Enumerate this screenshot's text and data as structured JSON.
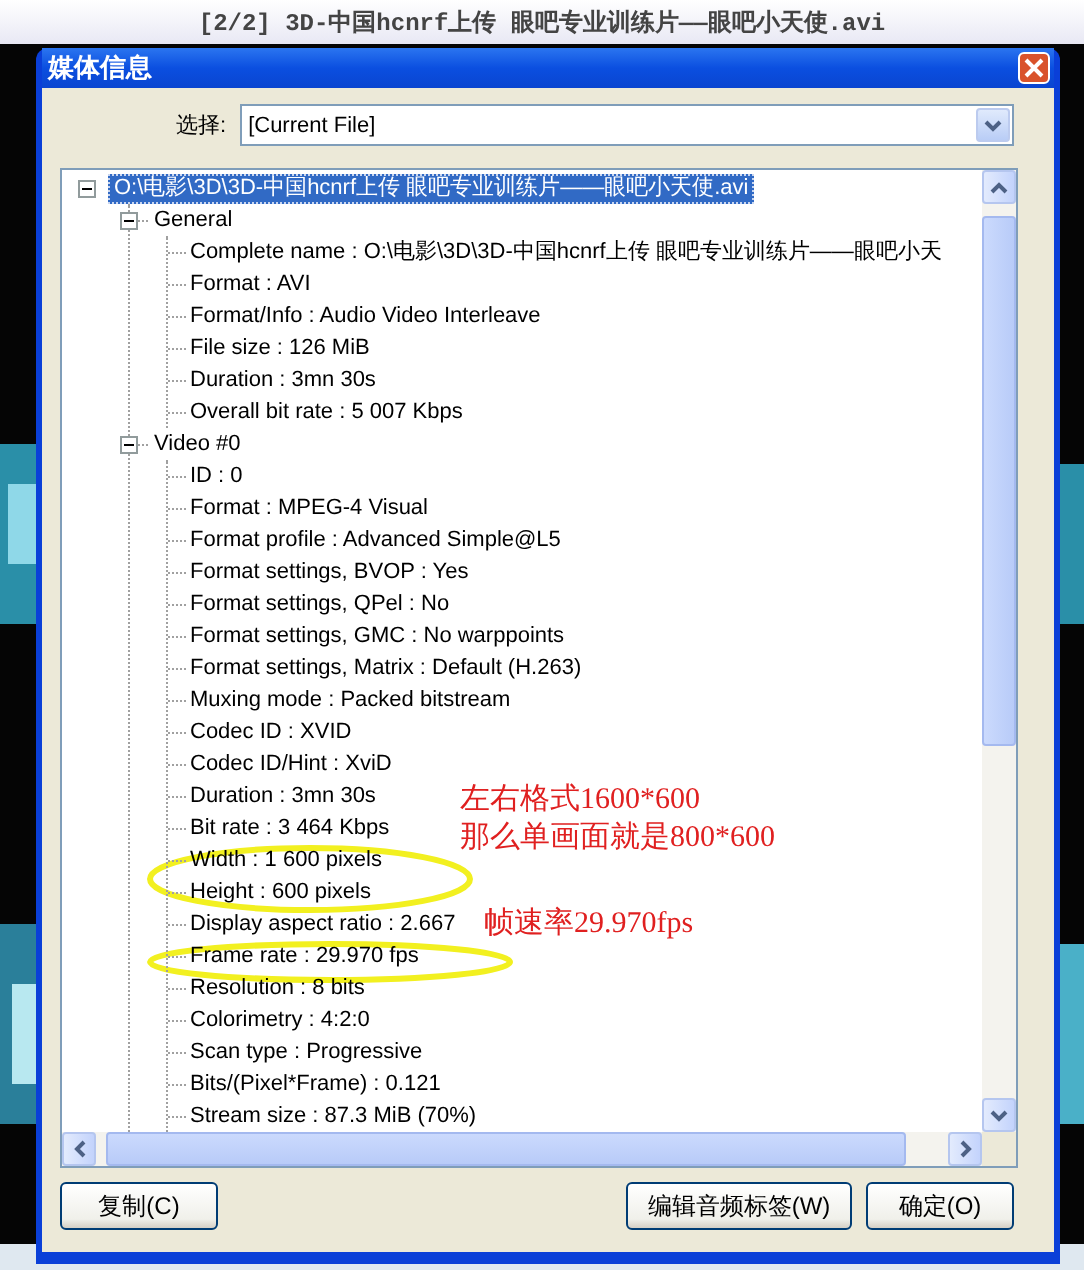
{
  "player_title": "[2/2] 3D-中国hcnrf上传 眼吧专业训练片——眼吧小天使.avi",
  "dialog": {
    "title": "媒体信息",
    "select_label": "选择:",
    "select_value": "[Current File]",
    "tree": {
      "label": "O:\\电影\\3D\\3D-中国hcnrf上传 眼吧专业训练片——眼吧小天使.avi",
      "expanded": true,
      "selected": true,
      "children": [
        {
          "label": "General",
          "expanded": true,
          "selected": false,
          "children": [
            {
              "label": "Complete name : O:\\电影\\3D\\3D-中国hcnrf上传 眼吧专业训练片——眼吧小天",
              "selected": false
            },
            {
              "label": "Format : AVI",
              "selected": false
            },
            {
              "label": "Format/Info : Audio Video Interleave",
              "selected": false
            },
            {
              "label": "File size : 126 MiB",
              "selected": false
            },
            {
              "label": "Duration : 3mn 30s",
              "selected": false
            },
            {
              "label": "Overall bit rate : 5 007 Kbps",
              "selected": false
            }
          ]
        },
        {
          "label": "Video #0",
          "expanded": true,
          "selected": false,
          "children": [
            {
              "label": "ID : 0",
              "selected": false
            },
            {
              "label": "Format : MPEG-4 Visual",
              "selected": false
            },
            {
              "label": "Format profile : Advanced Simple@L5",
              "selected": false
            },
            {
              "label": "Format settings, BVOP : Yes",
              "selected": false
            },
            {
              "label": "Format settings, QPel : No",
              "selected": false
            },
            {
              "label": "Format settings, GMC : No warppoints",
              "selected": false
            },
            {
              "label": "Format settings, Matrix : Default (H.263)",
              "selected": false
            },
            {
              "label": "Muxing mode : Packed bitstream",
              "selected": false
            },
            {
              "label": "Codec ID : XVID",
              "selected": false
            },
            {
              "label": "Codec ID/Hint : XviD",
              "selected": false
            },
            {
              "label": "Duration : 3mn 30s",
              "selected": false
            },
            {
              "label": "Bit rate : 3 464 Kbps",
              "selected": false
            },
            {
              "label": "Width : 1 600 pixels",
              "selected": false
            },
            {
              "label": "Height : 600 pixels",
              "selected": false
            },
            {
              "label": "Display aspect ratio : 2.667",
              "selected": false
            },
            {
              "label": "Frame rate : 29.970 fps",
              "selected": false
            },
            {
              "label": "Resolution : 8 bits",
              "selected": false
            },
            {
              "label": "Colorimetry : 4:2:0",
              "selected": false
            },
            {
              "label": "Scan type : Progressive",
              "selected": false
            },
            {
              "label": "Bits/(Pixel*Frame) : 0.121",
              "selected": false
            },
            {
              "label": "Stream size : 87.3 MiB (70%)",
              "selected": false
            }
          ]
        }
      ]
    },
    "annotations": [
      {
        "lines": [
          "左右格式1600*600",
          "那么单画面就是800*600"
        ]
      },
      {
        "lines": [
          "帧速率29.970fps"
        ]
      }
    ],
    "buttons": [
      {
        "label": "复制(C)"
      },
      {
        "label": "编辑音频标签(W)"
      },
      {
        "label": "确定(O)"
      }
    ]
  }
}
